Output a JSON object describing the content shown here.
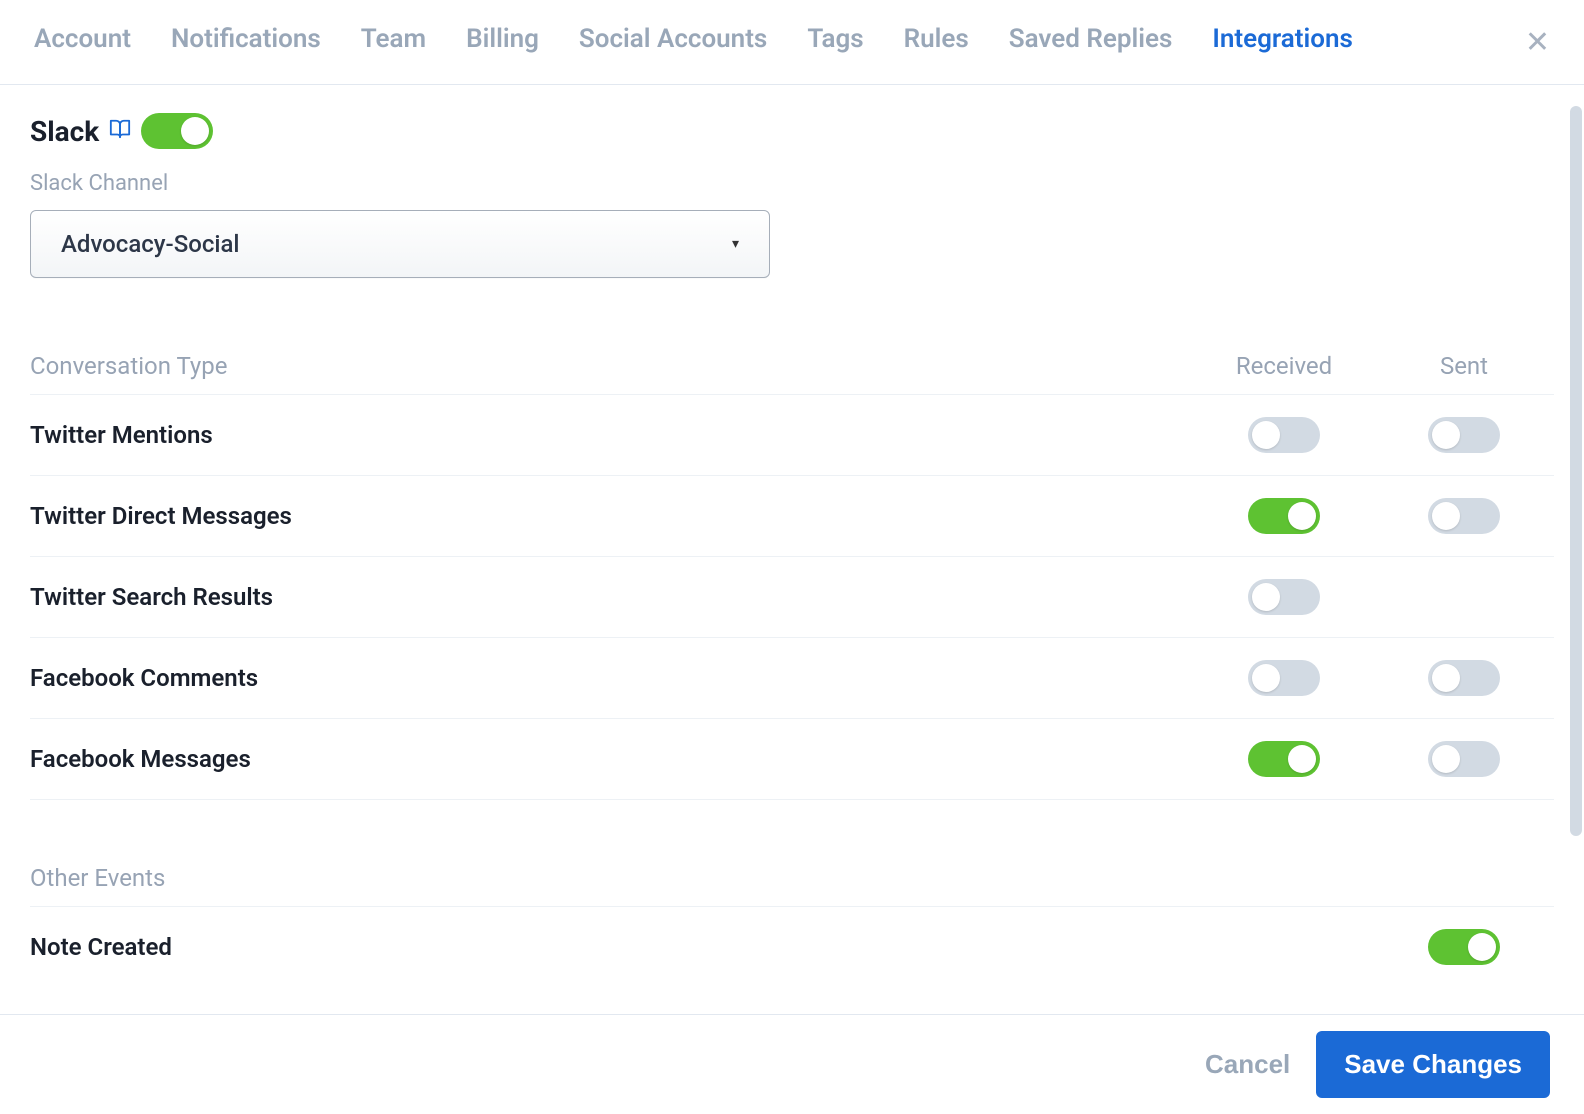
{
  "tabs": [
    {
      "label": "Account",
      "active": false
    },
    {
      "label": "Notifications",
      "active": false
    },
    {
      "label": "Team",
      "active": false
    },
    {
      "label": "Billing",
      "active": false
    },
    {
      "label": "Social Accounts",
      "active": false
    },
    {
      "label": "Tags",
      "active": false
    },
    {
      "label": "Rules",
      "active": false
    },
    {
      "label": "Saved Replies",
      "active": false
    },
    {
      "label": "Integrations",
      "active": true
    }
  ],
  "slack": {
    "title": "Slack",
    "enabled": true,
    "channel_label": "Slack Channel",
    "channel_selected": "Advocacy-Social"
  },
  "table_headers": {
    "type": "Conversation Type",
    "received": "Received",
    "sent": "Sent"
  },
  "conversation_rows": [
    {
      "label": "Twitter Mentions",
      "received": false,
      "sent": false,
      "has_sent": true
    },
    {
      "label": "Twitter Direct Messages",
      "received": true,
      "sent": false,
      "has_sent": true
    },
    {
      "label": "Twitter Search Results",
      "received": false,
      "sent": null,
      "has_sent": false
    },
    {
      "label": "Facebook Comments",
      "received": false,
      "sent": false,
      "has_sent": true
    },
    {
      "label": "Facebook Messages",
      "received": true,
      "sent": false,
      "has_sent": true
    }
  ],
  "other_events": {
    "heading": "Other Events",
    "rows": [
      {
        "label": "Note Created",
        "value": true
      }
    ]
  },
  "footer": {
    "cancel": "Cancel",
    "save": "Save Changes"
  }
}
